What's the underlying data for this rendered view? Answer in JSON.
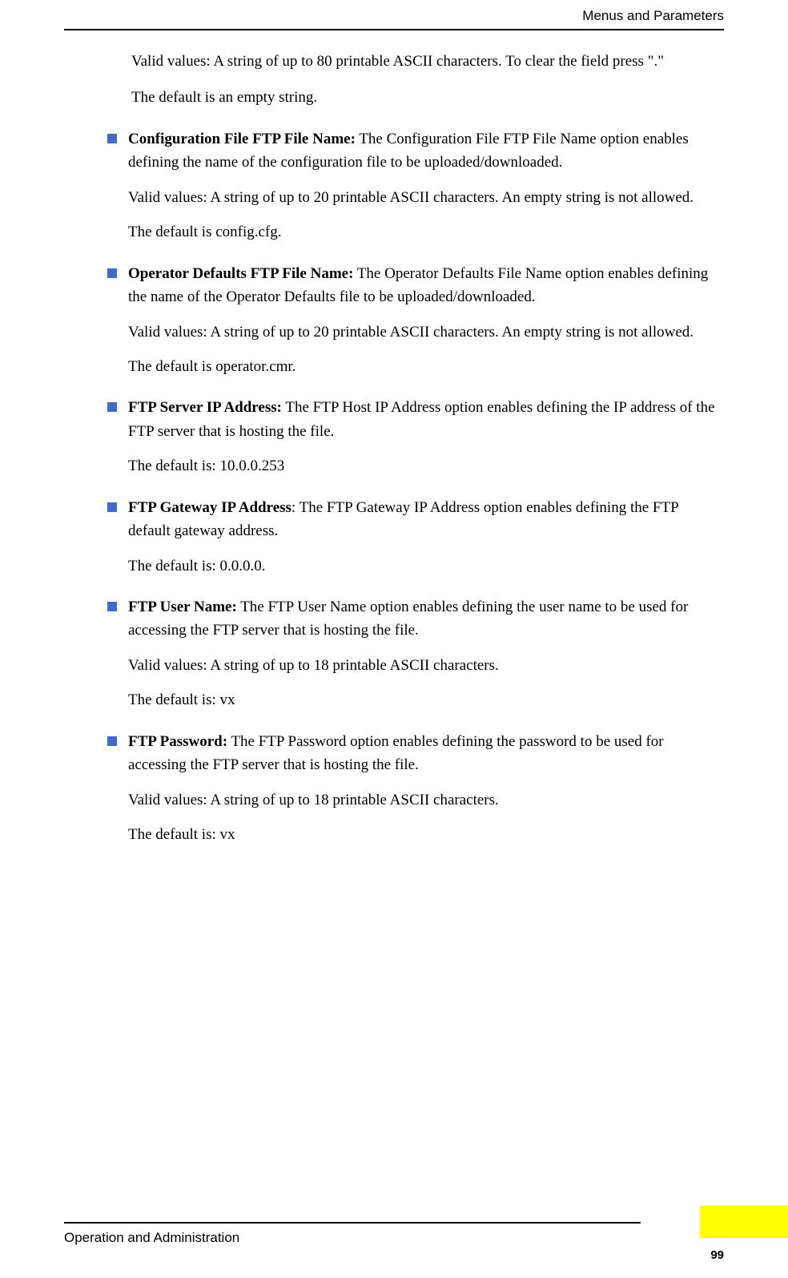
{
  "header": {
    "section": "Menus and Parameters"
  },
  "intro": {
    "p1": "Valid values: A string of up to 80 printable ASCII characters. To clear the field press \".\"",
    "p2": "The default is an empty string."
  },
  "items": [
    {
      "title": "Configuration File FTP File Name:",
      "desc": " The Configuration File FTP File Name option enables defining the name of the configuration file to be uploaded/downloaded.",
      "sub": [
        "Valid values: A string of up to 20 printable ASCII characters. An empty string is not allowed.",
        "The default is config.cfg."
      ]
    },
    {
      "title": "Operator Defaults FTP File Name:",
      "desc": " The Operator Defaults File Name option enables defining the name of the Operator Defaults file to be uploaded/downloaded.",
      "sub": [
        "Valid values: A string of up to 20 printable ASCII characters. An empty string is not allowed.",
        "The default is operator.cmr."
      ]
    },
    {
      "title": "FTP Server IP Address:",
      "desc": " The FTP Host IP Address option enables defining the IP address of the FTP server that is hosting the file.",
      "sub": [
        "The default is: 10.0.0.253"
      ]
    },
    {
      "title": "FTP Gateway IP Address",
      "desc": ": The FTP Gateway IP Address option enables defining the FTP default gateway address.",
      "sub": [
        "The default is: 0.0.0.0."
      ]
    },
    {
      "title": "FTP User Name:",
      "desc": " The FTP User Name option enables defining the user name to be used for accessing the FTP server that is hosting the file.",
      "sub": [
        "Valid values: A string of up to 18 printable ASCII characters.",
        "The default is: vx"
      ]
    },
    {
      "title": "FTP Password:",
      "desc": " The FTP Password option enables defining the password to be used for accessing the FTP server that is hosting the file.",
      "sub": [
        "Valid values: A string of up to 18 printable ASCII characters.",
        "The default is: vx"
      ]
    }
  ],
  "footer": {
    "text": "Operation and Administration",
    "page": "99"
  }
}
